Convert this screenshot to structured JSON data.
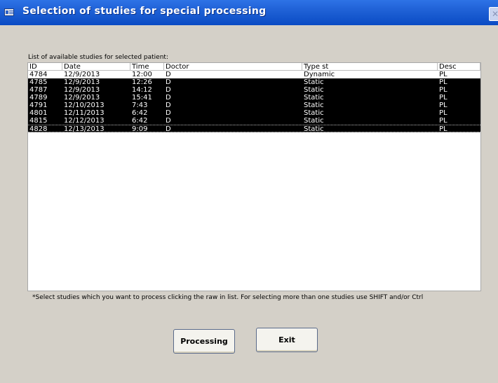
{
  "window": {
    "title": "Selection of studies for special processing",
    "close_symbol": "✕"
  },
  "list": {
    "label": "List of available studies for selected patient:",
    "columns": [
      "ID",
      "Date",
      "Time",
      "Doctor",
      "Type st",
      "Desc"
    ],
    "rows": [
      {
        "id": "4784",
        "date": "12/9/2013",
        "time": "12:00",
        "doctor": "D",
        "type": "Dynamic",
        "desc": "PL",
        "selected": false
      },
      {
        "id": "4785",
        "date": "12/9/2013",
        "time": "12:26",
        "doctor": "D",
        "type": "Static",
        "desc": "PL",
        "selected": true
      },
      {
        "id": "4787",
        "date": "12/9/2013",
        "time": "14:12",
        "doctor": "D",
        "type": "Static",
        "desc": "PL",
        "selected": true
      },
      {
        "id": "4789",
        "date": "12/9/2013",
        "time": "15:41",
        "doctor": "D",
        "type": "Static",
        "desc": "PL",
        "selected": true
      },
      {
        "id": "4791",
        "date": "12/10/2013",
        "time": "7:43",
        "doctor": "D",
        "type": "Static",
        "desc": "PL",
        "selected": true
      },
      {
        "id": "4801",
        "date": "12/11/2013",
        "time": "6:42",
        "doctor": "D",
        "type": "Static",
        "desc": "PL",
        "selected": true
      },
      {
        "id": "4815",
        "date": "12/12/2013",
        "time": "6:42",
        "doctor": "D",
        "type": "Static",
        "desc": "PL",
        "selected": true
      },
      {
        "id": "4828",
        "date": "12/13/2013",
        "time": "9:09",
        "doctor": "D",
        "type": "Static",
        "desc": "PL",
        "selected": true,
        "focused": true
      }
    ]
  },
  "hint": "*Select studies which you want to process clicking the raw in list. For selecting more than one studies use SHIFT and/or Ctrl",
  "buttons": {
    "processing": "Processing",
    "exit": "Exit"
  },
  "colors": {
    "title_bar": "#0a4bc4",
    "selection": "#000000",
    "window_bg": "#d4d0c8"
  }
}
